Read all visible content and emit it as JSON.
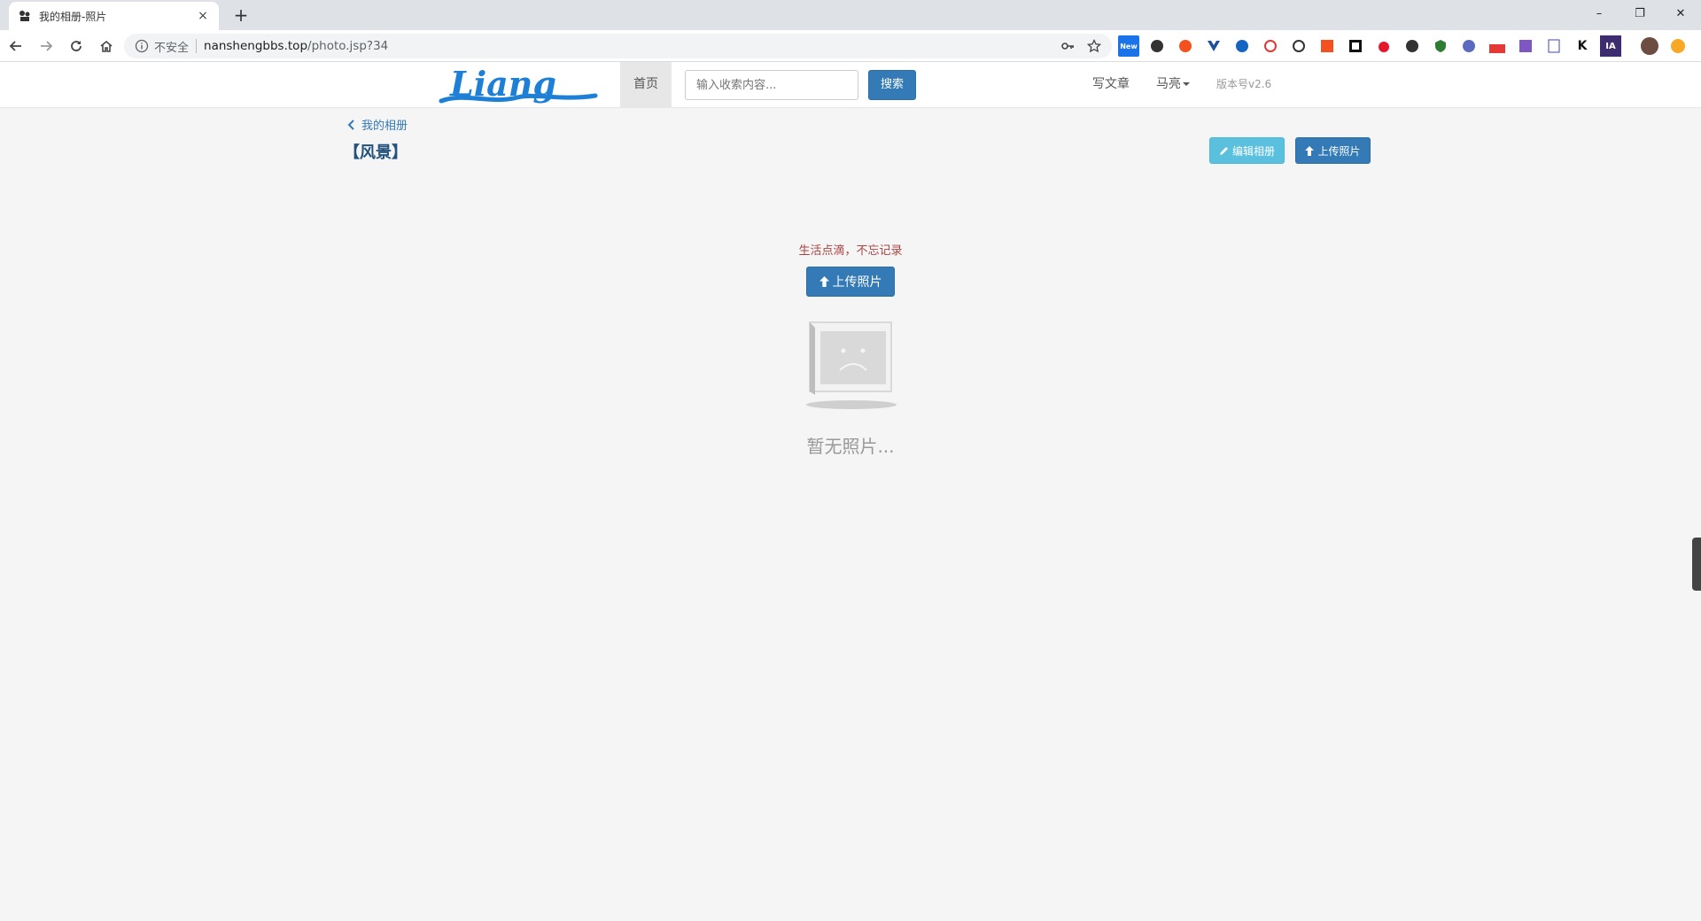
{
  "browser": {
    "tab": {
      "title": "我的相册-照片",
      "close": "×"
    },
    "new_tab": "+",
    "window": {
      "minimize": "–",
      "restore": "❐",
      "close": "✕"
    },
    "address": {
      "security_label": "不安全",
      "host": "nanshengbbs.top",
      "path": "/photo.jsp?34"
    },
    "extensions": [
      "New",
      "K",
      "IA"
    ]
  },
  "site": {
    "logo_text": "Liang",
    "nav": {
      "home": "首页",
      "search_placeholder": "输入收索内容...",
      "search_button": "搜索",
      "write": "写文章",
      "user": "马亮",
      "version": "版本号v2.6"
    }
  },
  "page": {
    "back_link": "我的相册",
    "album_title": "【风景】",
    "edit_button": "编辑相册",
    "upload_button": "上传照片",
    "empty_caption": "生活点滴，不忘记录",
    "upload_button_center": "上传照片",
    "empty_text": "暂无照片..."
  },
  "colors": {
    "primary": "#337ab7",
    "info": "#5bc0de",
    "caption": "#a94442",
    "logo": "#1e7fd6"
  }
}
